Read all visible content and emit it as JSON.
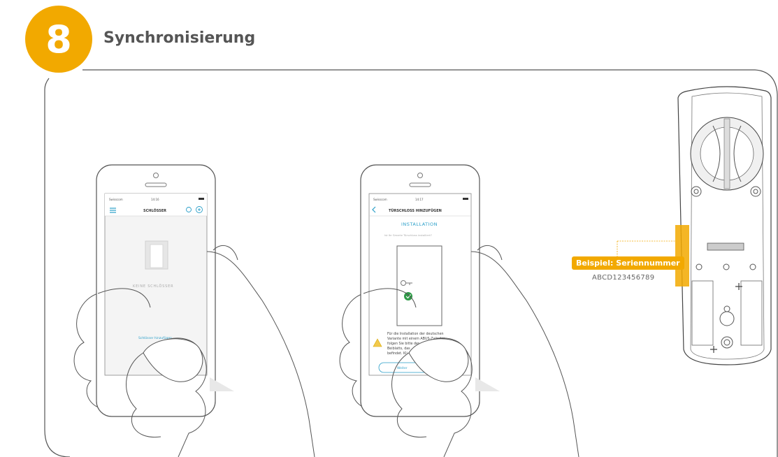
{
  "header": {
    "step_number": "8",
    "title": "Synchronisierung"
  },
  "phone1": {
    "status_carrier": "Swisscom",
    "status_time": "14:16",
    "screen_title": "SCHLÖSSER",
    "empty_text": "KEINE SCHLÖSSER",
    "add_button": "Schlösser hinzufügen"
  },
  "phone2": {
    "status_carrier": "Swisscom",
    "status_time": "14:17",
    "screen_title": "TÜRSCHLOSS HINZUFÜGEN",
    "section_title": "INSTALLATION",
    "subtitle": "Ist Ihr Smarte Türschloss installiert?",
    "note_lines": [
      "Für die Installation der deutschen",
      "Variante mit einem ABUS-Zylinder",
      "folgen Sie bitte der",
      "Beiblatts, das",
      "befindet. Kli"
    ],
    "button": "Weiter"
  },
  "lock": {
    "example_label": "Beispiel: Seriennummer",
    "serial_number": "ABCD123456789"
  },
  "colors": {
    "accent": "#f2a900",
    "phone_teal": "#2a9fc9",
    "check_green": "#2e9b47"
  }
}
